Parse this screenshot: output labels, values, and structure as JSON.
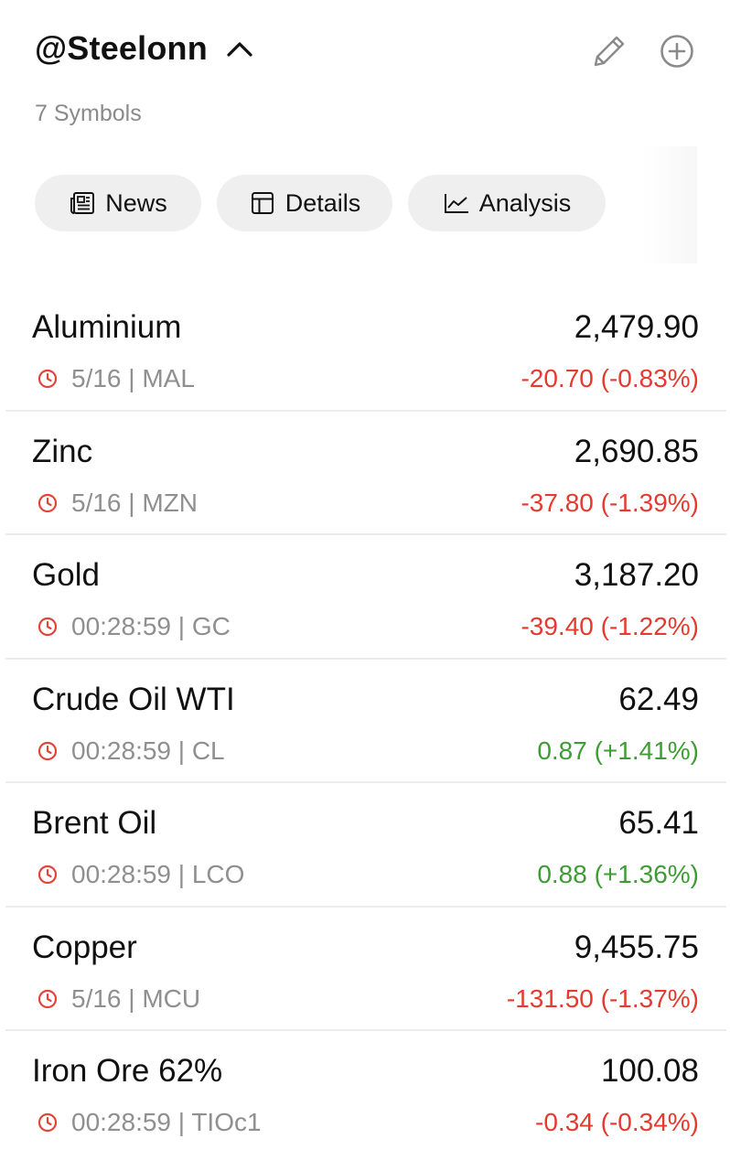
{
  "header": {
    "title": "@Steelonn",
    "subtitle": "7 Symbols"
  },
  "tabs": [
    {
      "label": "News",
      "icon": "newspaper-icon"
    },
    {
      "label": "Details",
      "icon": "table-icon"
    },
    {
      "label": "Analysis",
      "icon": "line-chart-icon"
    }
  ],
  "colors": {
    "negative": "#e53a2f",
    "positive": "#3f9c35",
    "clock": "#e0453a"
  },
  "symbols": [
    {
      "name": "Aluminium",
      "price": "2,479.90",
      "meta": "5/16 | MAL",
      "change": "-20.70 (-0.83%)",
      "direction": "down"
    },
    {
      "name": "Zinc",
      "price": "2,690.85",
      "meta": "5/16 | MZN",
      "change": "-37.80 (-1.39%)",
      "direction": "down"
    },
    {
      "name": "Gold",
      "price": "3,187.20",
      "meta": "00:28:59 | GC",
      "change": "-39.40 (-1.22%)",
      "direction": "down"
    },
    {
      "name": "Crude Oil WTI",
      "price": "62.49",
      "meta": "00:28:59 | CL",
      "change": "0.87 (+1.41%)",
      "direction": "up"
    },
    {
      "name": "Brent Oil",
      "price": "65.41",
      "meta": "00:28:59 | LCO",
      "change": "0.88 (+1.36%)",
      "direction": "up"
    },
    {
      "name": "Copper",
      "price": "9,455.75",
      "meta": "5/16 | MCU",
      "change": "-131.50 (-1.37%)",
      "direction": "down"
    },
    {
      "name": "Iron Ore 62%",
      "price": "100.08",
      "meta": "00:28:59 | TIOc1",
      "change": "-0.34 (-0.34%)",
      "direction": "down"
    }
  ]
}
